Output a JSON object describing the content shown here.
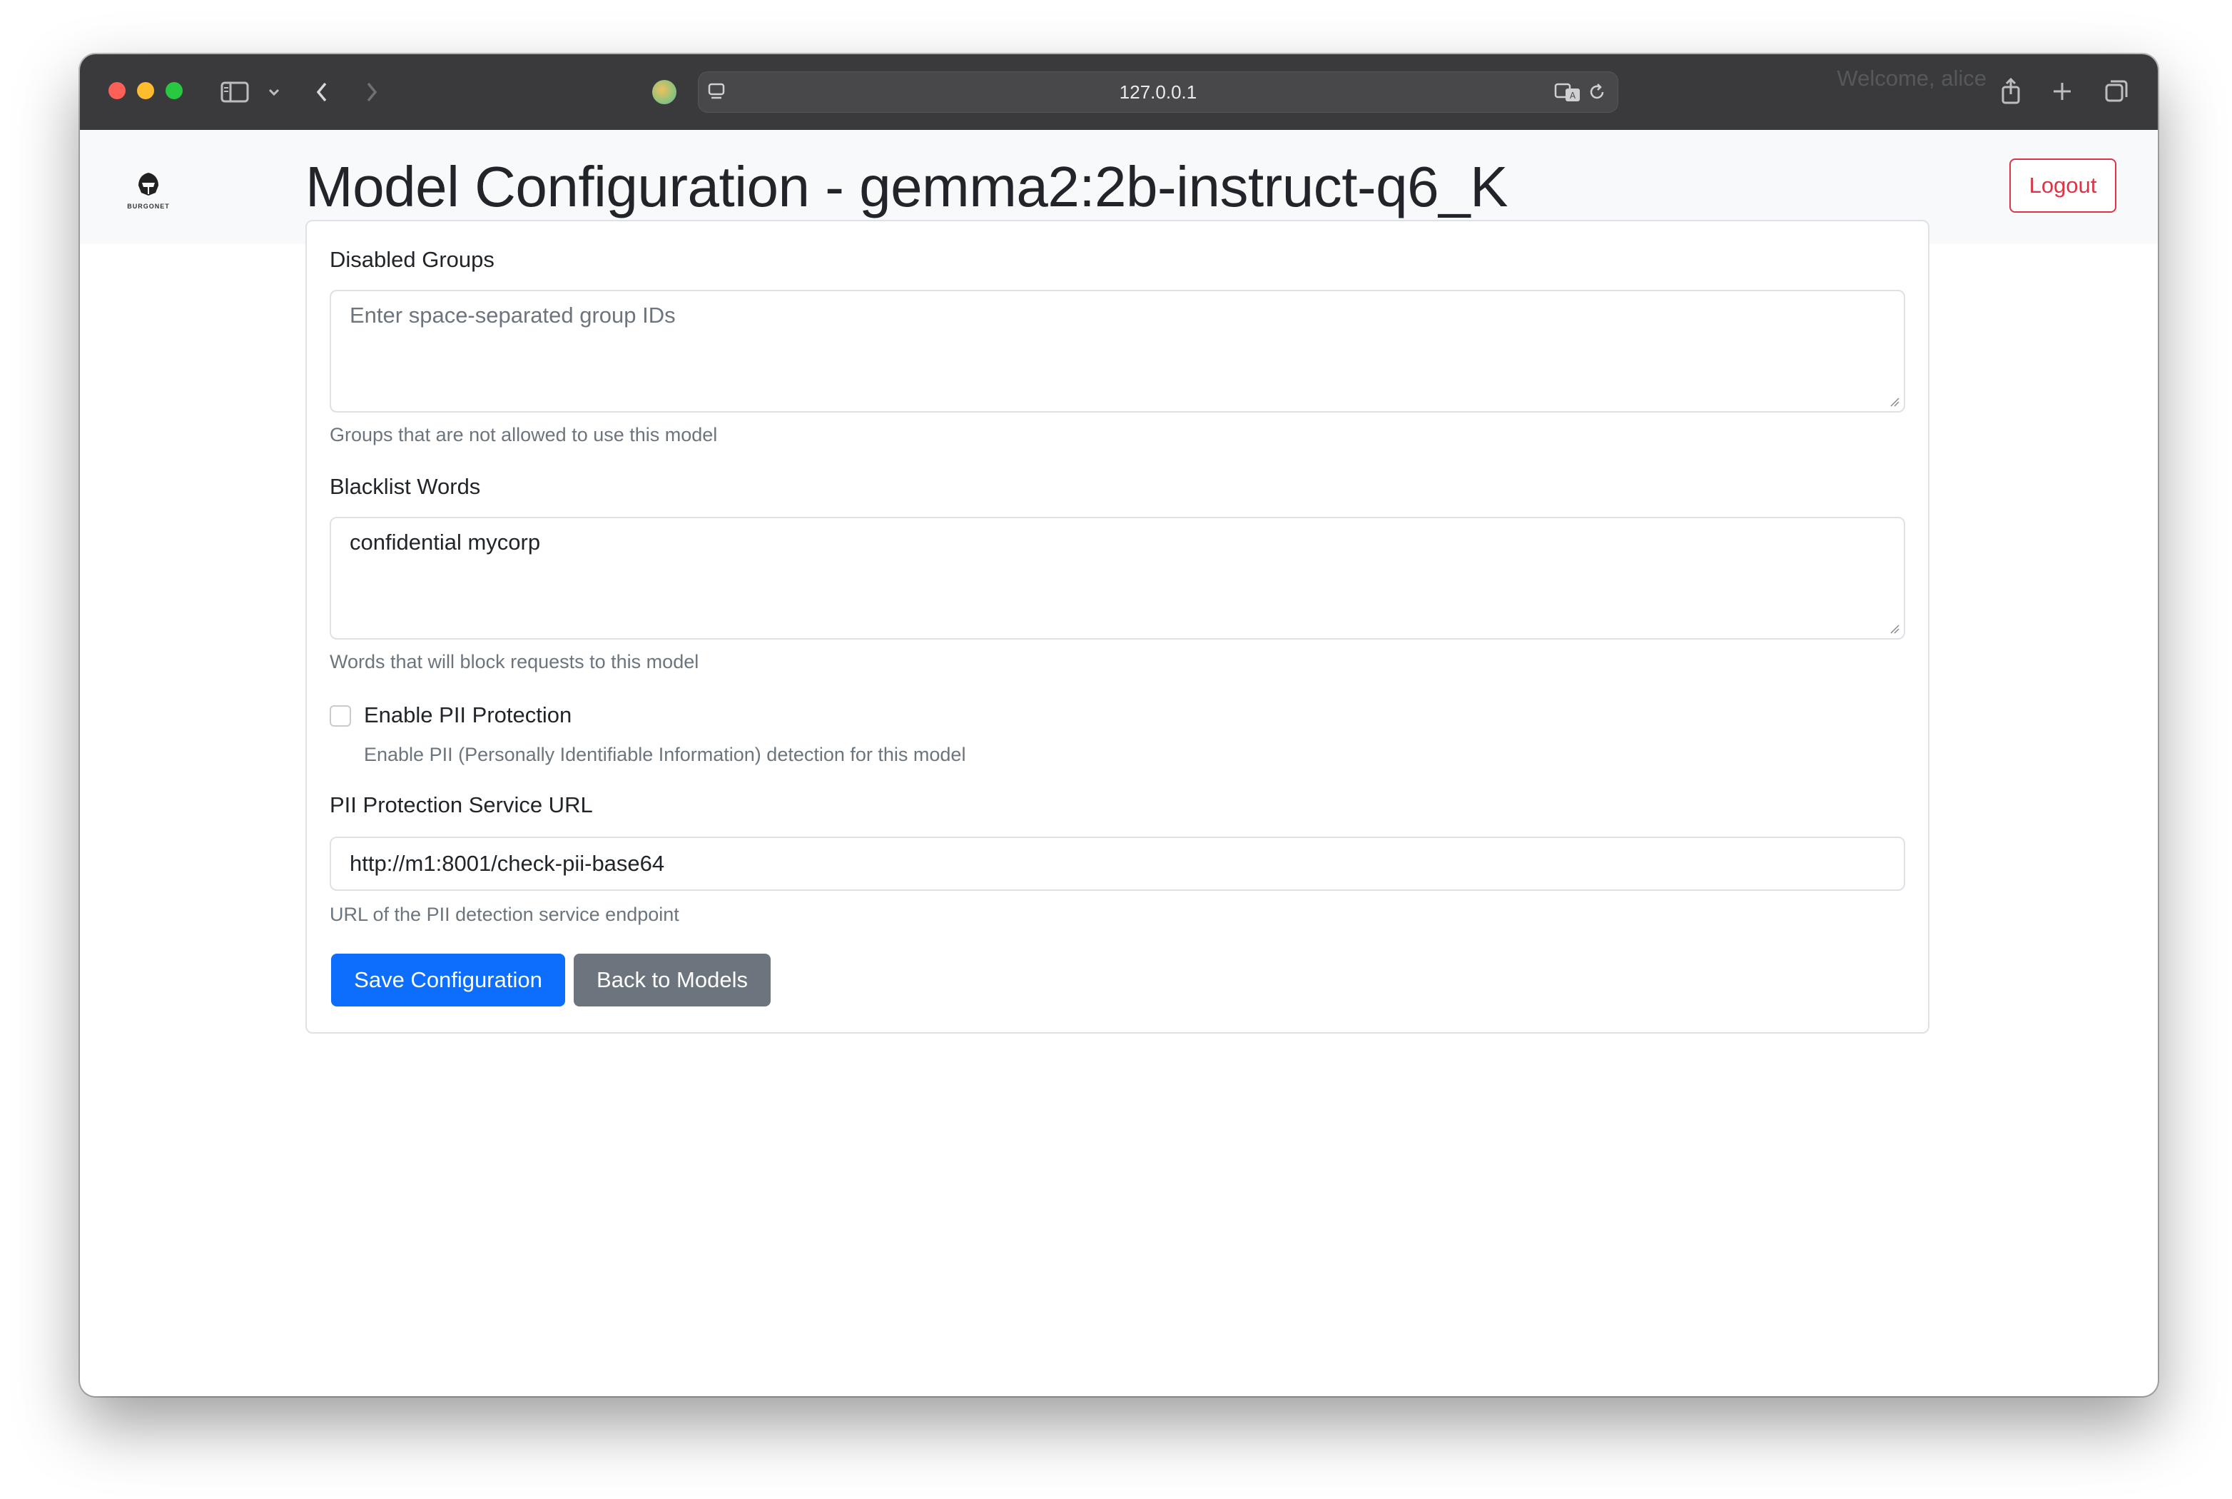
{
  "browser": {
    "url": "127.0.0.1"
  },
  "navbar": {
    "brand": "BURGONET",
    "welcome": "Welcome, alice",
    "logout_label": "Logout"
  },
  "page": {
    "title": "Model Configuration - gemma2:2b-instruct-q6_K"
  },
  "form": {
    "disabled_groups": {
      "label": "Disabled Groups",
      "placeholder": "Enter space-separated group IDs",
      "value": "",
      "help": "Groups that are not allowed to use this model"
    },
    "blacklist_words": {
      "label": "Blacklist Words",
      "value": "confidential mycorp",
      "help": "Words that will block requests to this model"
    },
    "pii_protection": {
      "label": "Enable PII Protection",
      "checked": false,
      "help": "Enable PII (Personally Identifiable Information) detection for this model"
    },
    "pii_url": {
      "label": "PII Protection Service URL",
      "value": "http://m1:8001/check-pii-base64",
      "help": "URL of the PII detection service endpoint"
    },
    "save_label": "Save Configuration",
    "back_label": "Back to Models"
  },
  "colors": {
    "primary": "#0d6efd",
    "secondary": "#6c757d",
    "danger": "#dc3545"
  }
}
